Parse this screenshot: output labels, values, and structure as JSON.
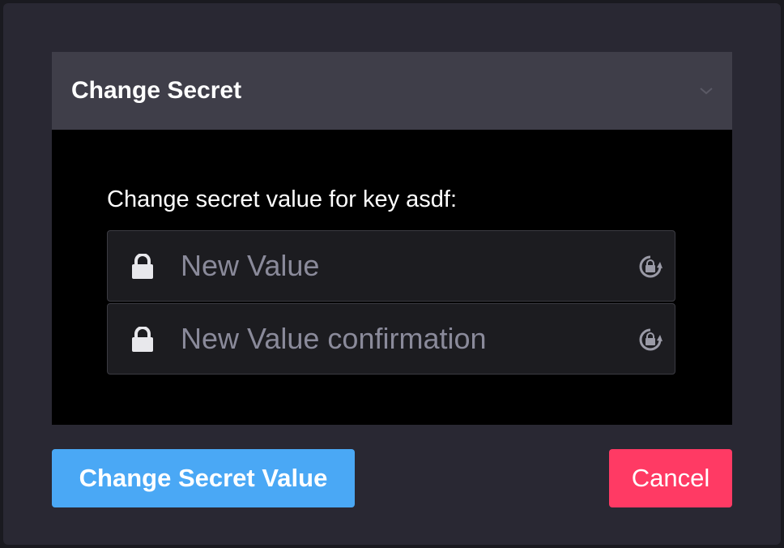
{
  "dialog": {
    "title": "Change Secret",
    "prompt": "Change secret value for key asdf:",
    "fields": [
      {
        "placeholder": "New Value",
        "value": ""
      },
      {
        "placeholder": "New Value confirmation",
        "value": ""
      }
    ],
    "primary_button": "Change Secret Value",
    "cancel_button": "Cancel"
  },
  "colors": {
    "primary": "#4aa8f5",
    "danger": "#ff3a64",
    "header_bg": "#3f3e49",
    "modal_bg": "#292833"
  },
  "icons": [
    "chevron-down-icon",
    "lock-icon",
    "regenerate-icon"
  ]
}
